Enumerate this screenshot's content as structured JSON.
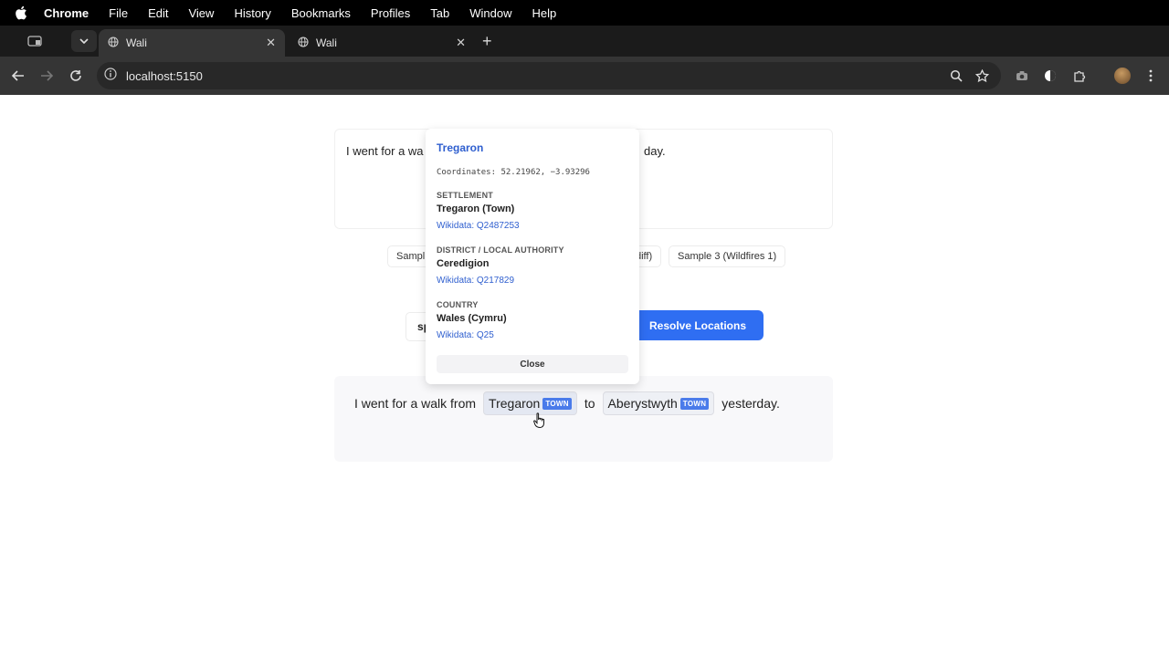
{
  "menubar": {
    "app_name": "Chrome",
    "items": [
      "File",
      "Edit",
      "View",
      "History",
      "Bookmarks",
      "Profiles",
      "Tab",
      "Window",
      "Help"
    ]
  },
  "browser": {
    "tabs": [
      {
        "title": "Wali",
        "active": true
      },
      {
        "title": "Wali",
        "active": false
      }
    ],
    "new_tab_label": "+",
    "url": "localhost:5150",
    "profile_color": "#8a6236"
  },
  "page": {
    "input_text_start": "I went for a wa",
    "input_text_end": "day.",
    "samples": [
      "Sampl",
      "diff)",
      "Sample 3 (Wildfires 1)"
    ],
    "model_select_value": "sp",
    "resolve_button": "Resolve Locations",
    "result": {
      "before": "I went for a walk from",
      "place1": "Tregaron",
      "place1_type": "TOWN",
      "middle": "to",
      "place2": "Aberystwyth",
      "place2_type": "TOWN",
      "after": "yesterday."
    },
    "accent_color": "#2f6ef2"
  },
  "popup": {
    "title": "Tregaron",
    "coordinates": "Coordinates: 52.21962, −3.93296",
    "sections": [
      {
        "label": "SETTLEMENT",
        "value": "Tregaron (Town)",
        "link": "Wikidata: Q2487253"
      },
      {
        "label": "DISTRICT / LOCAL AUTHORITY",
        "value": "Ceredigion",
        "link": "Wikidata: Q217829"
      },
      {
        "label": "COUNTRY",
        "value": "Wales (Cymru)",
        "link": "Wikidata: Q25"
      }
    ],
    "close_label": "Close"
  }
}
